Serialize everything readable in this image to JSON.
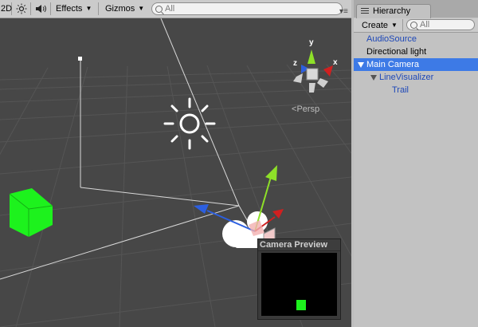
{
  "scene_toolbar": {
    "mode_2d": "2D",
    "effects_label": "Effects",
    "gizmos_label": "Gizmos",
    "search_placeholder": "All"
  },
  "scene": {
    "persp_label": "Persp",
    "gizmo_axes": {
      "y": "y",
      "x": "x",
      "z": "z"
    }
  },
  "camera_preview": {
    "title": "Camera Preview"
  },
  "hierarchy": {
    "tab_label": "Hierarchy",
    "create_label": "Create",
    "search_placeholder": "All",
    "items": [
      {
        "label": "AudioSource",
        "color": "#1e48b8"
      },
      {
        "label": "Directional light",
        "color": "#000000"
      },
      {
        "label": "Main Camera",
        "color": "#ffffff",
        "selected": true
      },
      {
        "label": "LineVisualizer",
        "color": "#1e48b8"
      },
      {
        "label": "Trail",
        "color": "#1e48b8"
      }
    ]
  },
  "colors": {
    "selection": "#3d7ae6",
    "prefab_text": "#1e48b8",
    "cube_green": "#1df21d"
  }
}
